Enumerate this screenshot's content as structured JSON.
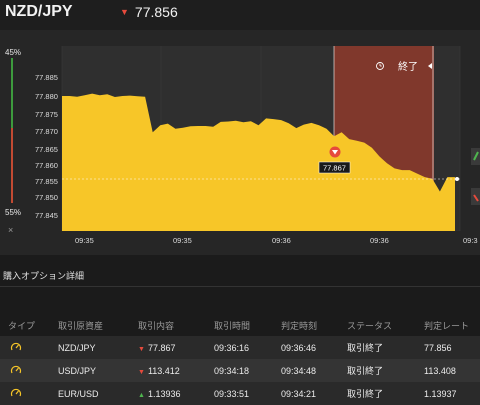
{
  "header": {
    "pair": "NZD/JPY",
    "rate": "77.856",
    "direction_icon": "down-arrow-icon"
  },
  "gauge": {
    "top_pct": "45%",
    "bottom_pct": "55%",
    "close": "×"
  },
  "chart": {
    "y_ticks": [
      "77.885",
      "77.880",
      "77.875",
      "77.870",
      "77.865",
      "77.860",
      "77.855",
      "77.850",
      "77.845"
    ],
    "x_ticks": [
      "09:35",
      "09:35",
      "09:36",
      "09:36",
      "09:36",
      "09:3"
    ],
    "end_label": "終了",
    "marker_rate": "77.867",
    "price_series": [
      77.8795,
      77.8795,
      77.8793,
      77.8797,
      77.8802,
      77.8797,
      77.88,
      77.8792,
      77.8795,
      77.8796,
      77.8794,
      77.8793,
      77.869,
      77.871,
      77.8715,
      77.87,
      77.8703,
      77.8707,
      77.8708,
      77.8708,
      77.8706,
      77.872,
      77.8721,
      77.8723,
      77.8719,
      77.8722,
      77.871,
      77.873,
      77.8728,
      77.8725,
      77.8716,
      77.8702,
      77.8712,
      77.8717,
      77.871,
      77.87,
      77.8678,
      77.869,
      77.867,
      77.8665,
      77.866,
      77.8645,
      77.862,
      77.86,
      77.8585,
      77.858,
      77.858,
      77.857,
      77.856,
      77.8555,
      77.8518,
      77.856,
      77.856
    ]
  },
  "details": {
    "title": "購入オプション詳細",
    "columns": [
      "タイプ",
      "取引原資産",
      "取引内容",
      "取引時間",
      "判定時刻",
      "ステータス",
      "判定レート"
    ],
    "rows": [
      {
        "asset": "NZD/JPY",
        "dir": "down",
        "content": "77.867",
        "time": "09:36:16",
        "judge": "09:36:46",
        "status": "取引終了",
        "rate": "77.856"
      },
      {
        "asset": "USD/JPY",
        "dir": "down",
        "content": "113.412",
        "time": "09:34:18",
        "judge": "09:34:48",
        "status": "取引終了",
        "rate": "113.408"
      },
      {
        "asset": "EUR/USD",
        "dir": "up",
        "content": "1.13936",
        "time": "09:33:51",
        "judge": "09:34:21",
        "status": "取引終了",
        "rate": "1.13937"
      }
    ]
  },
  "colors": {
    "accent": "#f7c628",
    "down": "#e64a3c",
    "up": "#4fb54f",
    "expired": "#8a3a2c"
  }
}
